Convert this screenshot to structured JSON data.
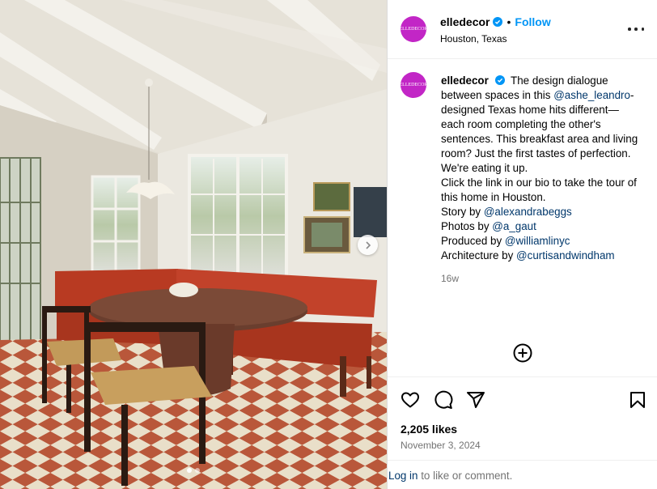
{
  "post": {
    "username": "elledecor",
    "avatar_text": "ELLEDECOR",
    "follow_label": "Follow",
    "separator": "•",
    "location": "Houston, Texas",
    "more_icon": "more-horizontal-icon"
  },
  "caption": {
    "text_1": " The design dialogue between spaces in this ",
    "mention_1": "@ashe_leandro",
    "text_2": "-designed Texas home hits different—each room completing the other's sentences. This breakfast area and living room? Just the first tastes of perfection. We're eating it up.",
    "text_3": "Click the link in our bio to take the tour of this home in Houston.",
    "credits": [
      {
        "label": "Story by ",
        "mention": "@alexandrabeggs"
      },
      {
        "label": "Photos by ",
        "mention": "@a_gaut"
      },
      {
        "label": "Produced by ",
        "mention": "@williamlinyc"
      },
      {
        "label": "Architecture by ",
        "mention": "@curtisandwindham"
      }
    ],
    "age": "16w"
  },
  "engagement": {
    "likes": "2,205 likes",
    "date": "November 3, 2024"
  },
  "login": {
    "link": "Log in",
    "rest": " to like or comment."
  },
  "carousel": {
    "slide_count": 2,
    "active_slide": 1
  },
  "colors": {
    "avatar": "#c226c6",
    "follow": "#0095f6",
    "verified": "#0095f6",
    "mention": "#00376b",
    "muted": "#737373"
  }
}
